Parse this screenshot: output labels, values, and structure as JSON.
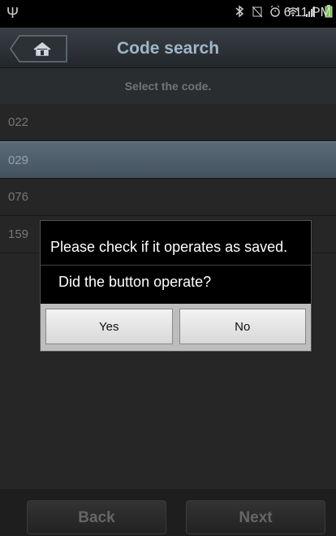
{
  "status_bar": {
    "time": "6:11 PM",
    "icons": [
      "usb-icon",
      "bluetooth-icon",
      "no-sim-icon",
      "alarm-icon",
      "wifi-icon",
      "signal-icon",
      "battery-icon"
    ]
  },
  "header": {
    "title": "Code search",
    "home_icon": "home-icon"
  },
  "subtitle": "Select the code.",
  "codes": [
    {
      "label": "022",
      "selected": false
    },
    {
      "label": "029",
      "selected": true
    },
    {
      "label": "076",
      "selected": false
    },
    {
      "label": "159",
      "selected": false
    }
  ],
  "dialog": {
    "message": "Please check if it operates as saved.",
    "question": "Did the button operate?",
    "yes_label": "Yes",
    "no_label": "No"
  },
  "footer": {
    "back_label": "Back",
    "next_label": "Next"
  },
  "colors": {
    "accent_title": "#9fb6c8",
    "selected_row": "#4e5e6a"
  }
}
